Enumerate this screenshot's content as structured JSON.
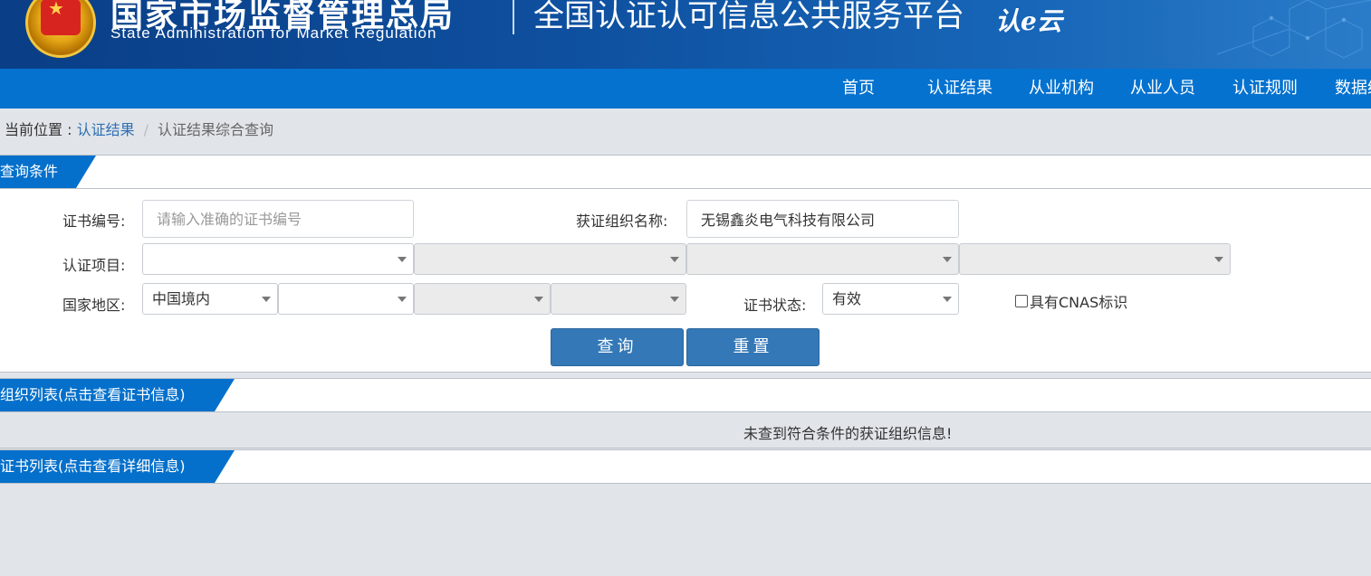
{
  "header": {
    "agency_cn": "国家市场监督管理总局",
    "agency_en": "State Administration  for  Market Regulation",
    "platform_title": "全国认证认可信息公共服务平台",
    "logo_text": "认e云"
  },
  "nav": {
    "items": [
      {
        "label": "首页"
      },
      {
        "label": "认证结果"
      },
      {
        "label": "从业机构"
      },
      {
        "label": "从业人员"
      },
      {
        "label": "认证规则"
      },
      {
        "label": "数据统"
      }
    ]
  },
  "breadcrumb": {
    "prefix": "当前位置 : ",
    "parent": "认证结果",
    "separator": "/",
    "current": "认证结果综合查询"
  },
  "query_panel": {
    "title": "查询条件",
    "cert_no_label": "证书编号:",
    "cert_no_value": "",
    "cert_no_placeholder": "请输入准确的证书编号",
    "org_name_label": "获证组织名称:",
    "org_name_value": "无锡鑫炎电气科技有限公司",
    "project_label": "认证项目:",
    "region_label": "国家地区:",
    "region_selected": "中国境内",
    "status_label": "证书状态:",
    "status_selected": "有效",
    "cnas_label": "具有CNAS标识",
    "search_button": "查询",
    "reset_button": "重置"
  },
  "org_list": {
    "title": "组织列表(点击查看证书信息)",
    "empty_message": "未查到符合条件的获证组织信息!"
  },
  "cert_list": {
    "title": "证书列表(点击查看详细信息)"
  },
  "colors": {
    "header_blue": "#0e4f9e",
    "nav_blue": "#0572cf",
    "tab_blue": "#0570cb",
    "button_blue": "#3478b7",
    "page_bg": "#e1e5e9"
  }
}
